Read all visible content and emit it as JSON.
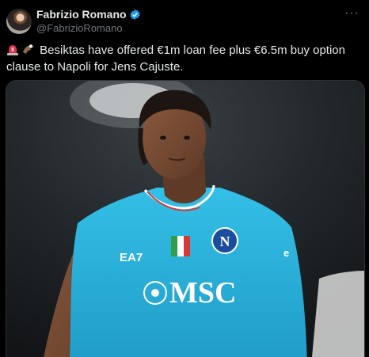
{
  "author": {
    "display_name": "Fabrizio Romano",
    "handle": "@FabrizioRomano",
    "verified": true
  },
  "tweet": {
    "text": "Besiktas have offered €1m loan fee plus €6.5m buy option clause to Napoli for Jens Cajuste.",
    "emojis": [
      "siren-icon",
      "eagle-icon"
    ]
  },
  "media": {
    "jersey_brand": "EA7",
    "jersey_sponsor": "MSC",
    "badge_letter": "N",
    "jersey_color": "#2bb5de"
  },
  "colors": {
    "background": "#000000",
    "text": "#e7e9ea",
    "secondary": "#71767b",
    "verified_blue": "#1d9bf0"
  }
}
